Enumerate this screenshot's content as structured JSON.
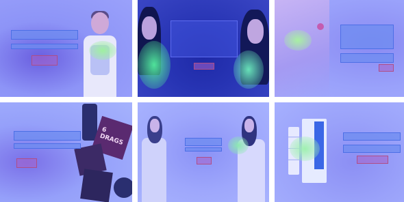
{
  "grid": {
    "tiles": [
      {
        "subject": "child-in-bib"
      },
      {
        "subject": "two-women-holding-products"
      },
      {
        "subject": "hands-close-up"
      },
      {
        "subject": "product-packages"
      },
      {
        "subject": "two-women-standing"
      },
      {
        "subject": "product-box"
      }
    ]
  },
  "tiles": {
    "t4": {
      "pack_text": "6 DRAGS"
    }
  },
  "colors": {
    "overlay_blue": "#8f95f6",
    "box_blue_border": "#4c6fe6",
    "box_red_border": "#b04e86",
    "tile2_dark": "#2734b4",
    "heat_green": "#9ff0a0"
  }
}
